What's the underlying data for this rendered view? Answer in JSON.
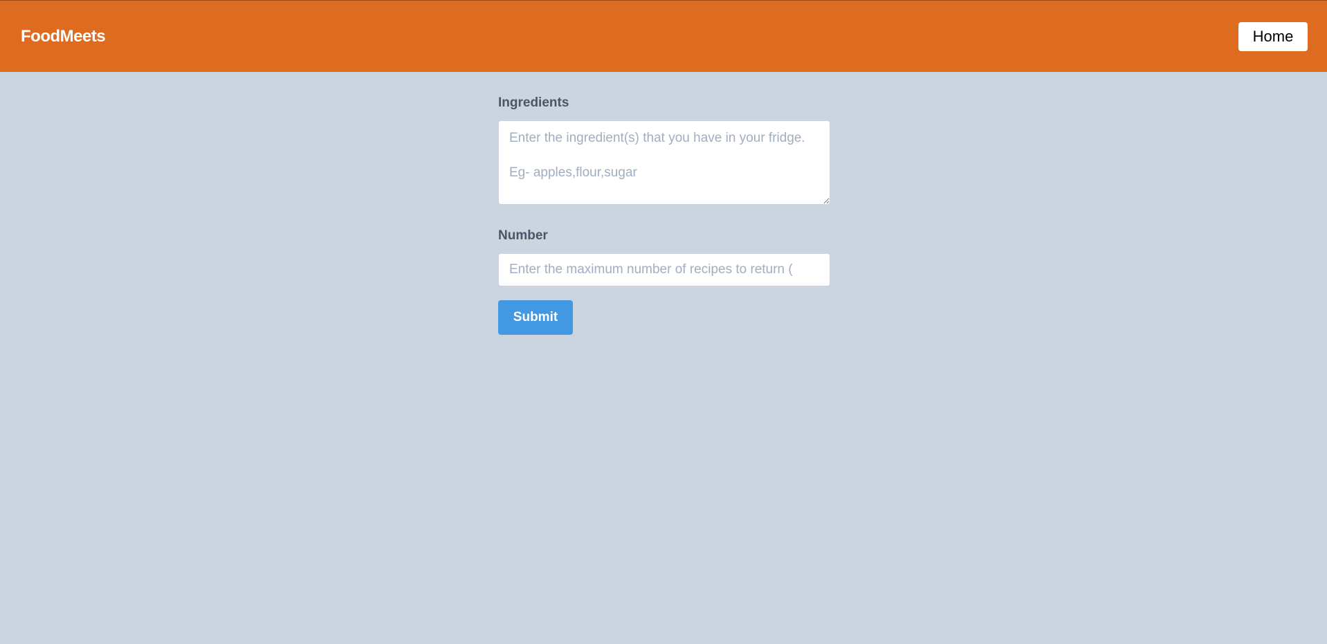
{
  "navbar": {
    "brand": "FoodMeets",
    "home_label": "Home",
    "background_color": "#dd6b20"
  },
  "form": {
    "ingredients": {
      "label": "Ingredients",
      "placeholder": "Enter the ingredient(s) that you have in your fridge.\n\nEg- apples,flour,sugar",
      "value": ""
    },
    "number": {
      "label": "Number",
      "placeholder": "Enter the maximum number of recipes to return (",
      "value": ""
    },
    "submit_label": "Submit",
    "submit_color": "#4299e1"
  },
  "page": {
    "background_color": "#cbd5e0"
  }
}
